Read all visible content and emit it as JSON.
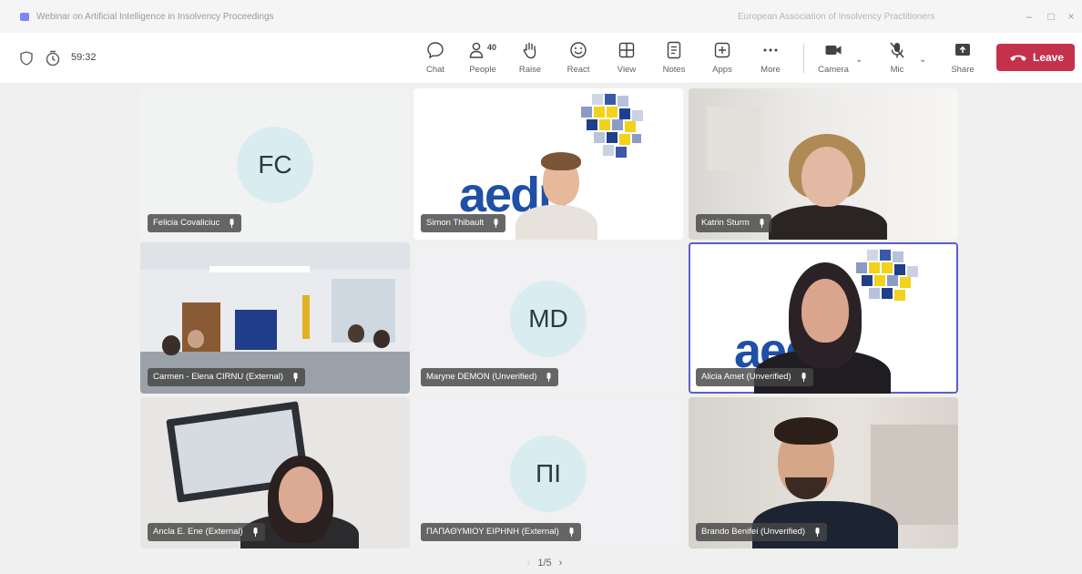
{
  "window": {
    "title": "Webinar on Artificial Intelligence in Insolvency Proceedings",
    "org": "European Association of Insolvency Practitioners"
  },
  "toolbar": {
    "timer": "59:32",
    "people_count": "40",
    "chat_label": "Chat",
    "people_label": "People",
    "raise_label": "Raise",
    "react_label": "React",
    "view_label": "View",
    "notes_label": "Notes",
    "apps_label": "Apps",
    "more_label": "More",
    "camera_label": "Camera",
    "mic_label": "Mic",
    "share_label": "Share",
    "leave_label": "Leave"
  },
  "participants": [
    {
      "name": "Felicia Covaliciuc",
      "initials": "FC",
      "avatar_color": "#d9edf0"
    },
    {
      "name": "Simon Thibault"
    },
    {
      "name": "Katrin Sturm"
    },
    {
      "name": "Carmen - Elena CIRNU (External)"
    },
    {
      "name": "Maryne DEMON (Unverified)",
      "initials": "MD",
      "avatar_color": "#d9edf0"
    },
    {
      "name": "Alicia Amet (Unverified)"
    },
    {
      "name": "Ancla E. Ene (External)"
    },
    {
      "name": "ΠΑΠΑΘΥΜΙΟΥ ΕΙΡΗΝΗ (External)",
      "initials": "ΠΙ",
      "avatar_color": "#d9edf0"
    },
    {
      "name": "Brando Benifei (Unverified)"
    }
  ],
  "brand": {
    "logo_text": "aedn"
  },
  "pager": {
    "label": "1/5"
  },
  "colors": {
    "accent": "#5b5fc7",
    "leave": "#c4314b",
    "logo_blue": "#1f4fa6",
    "logo_yellow": "#f2d21b"
  }
}
